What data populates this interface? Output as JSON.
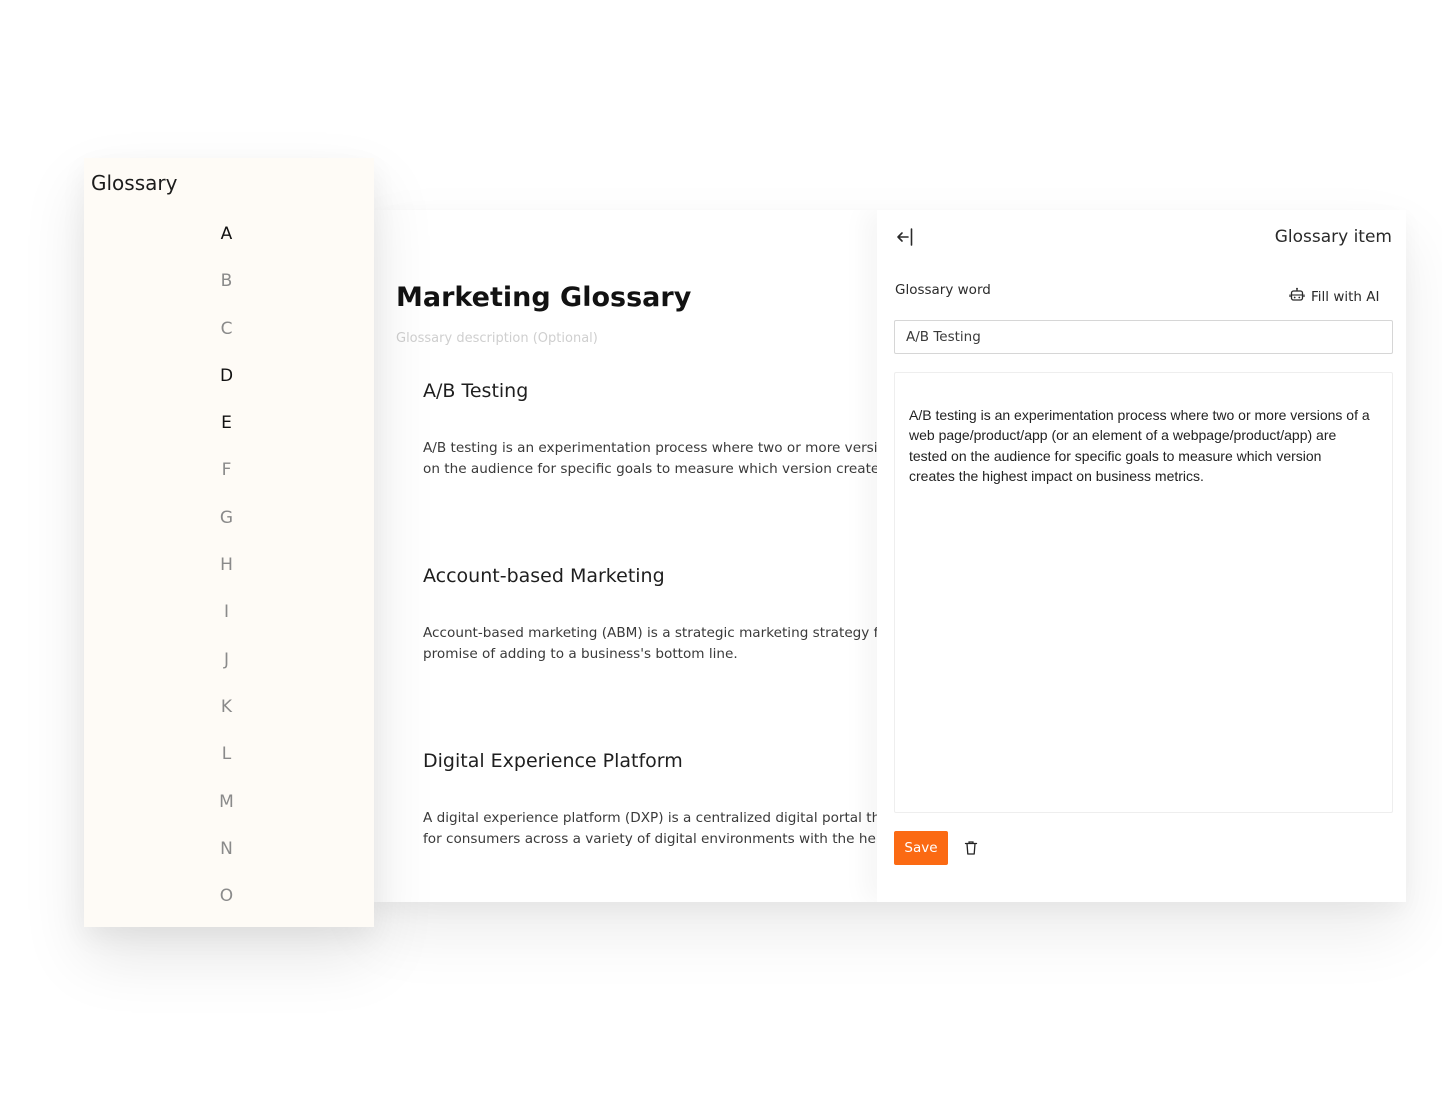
{
  "sidebar": {
    "title": "Glossary",
    "letters": [
      "A",
      "B",
      "C",
      "D",
      "E",
      "F",
      "G",
      "H",
      "I",
      "J",
      "K",
      "L",
      "M",
      "N",
      "O"
    ],
    "active_letters": [
      "A",
      "D",
      "E"
    ]
  },
  "glossary": {
    "title": "Marketing Glossary",
    "description_placeholder": "Glossary description (Optional)",
    "entries": [
      {
        "title": "A/B Testing",
        "body_lines": [
          "A/B testing is an experimentation process where two or more versions of a web page/product/app (or an element of a webpage/product/app) are tested",
          "on the audience for specific goals to measure which version creates the highest impact on business metrics."
        ]
      },
      {
        "title": "Account-based Marketing",
        "body_lines": [
          "Account-based marketing (ABM) is a strategic marketing strategy focused on targeting accounts that hold the",
          "promise of adding to a business's bottom line."
        ]
      },
      {
        "title": "Digital Experience Platform",
        "body_lines": [
          "A digital experience platform (DXP) is a centralized digital portal that enables businesses to build, manage and optimize digital experiences",
          "for consumers across a variety of digital environments with the help of connected tools."
        ]
      }
    ]
  },
  "panel": {
    "back_icon": "arrow-left-bar-icon",
    "title": "Glossary item",
    "word_label": "Glossary word",
    "fill_ai_label": "Fill with AI",
    "fill_ai_icon": "robot-icon",
    "word_value": "A/B Testing",
    "definition_lines": [
      "A/B testing is an experimentation process where two or more versions of a",
      "web page/product/app (or an element of a webpage/product/app) are",
      "tested on the audience for specific goals to measure which version",
      "creates the highest impact on business metrics."
    ],
    "save_label": "Save",
    "delete_icon": "trash-icon",
    "accent_color": "#fb6a13"
  }
}
